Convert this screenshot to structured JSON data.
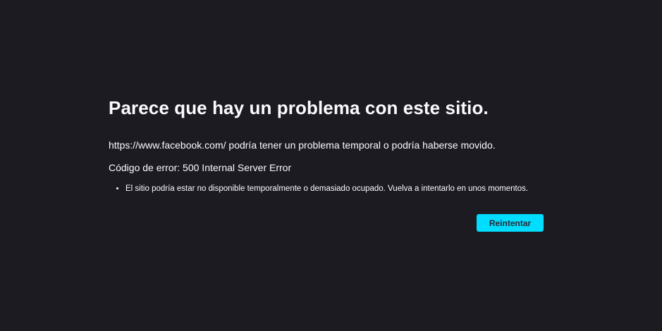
{
  "error_page": {
    "title": "Parece que hay un problema con este sitio.",
    "description": "https://www.facebook.com/ podría tener un problema temporal o podría haberse movido.",
    "error_code": "Código de error: 500 Internal Server Error",
    "hints": [
      "El sitio podría estar no disponible temporalmente o demasiado ocupado. Vuelva a intentarlo en unos momentos."
    ],
    "retry_label": "Reintentar"
  },
  "colors": {
    "background": "#1c1b22",
    "text": "#fbfbfe",
    "accent": "#00ddff"
  }
}
